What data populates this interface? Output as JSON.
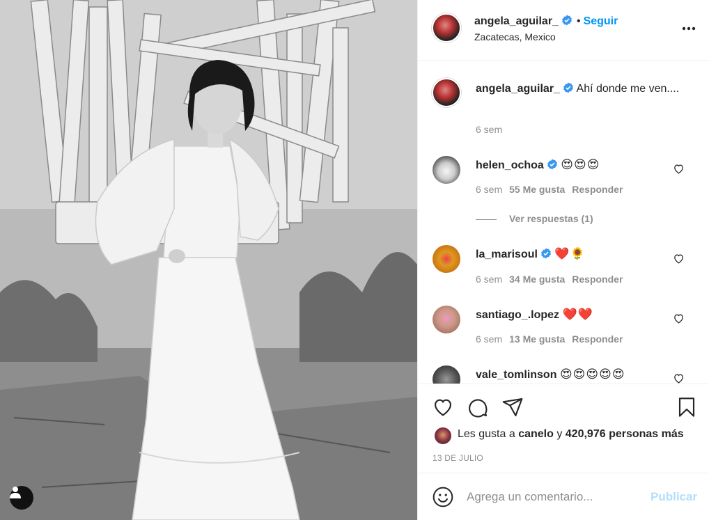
{
  "header": {
    "username": "angela_aguilar_",
    "separator": "•",
    "follow_label": "Seguir",
    "location": "Zacatecas, Mexico"
  },
  "caption": {
    "username": "angela_aguilar_",
    "text": "Ahí donde me ven....",
    "time": "6 sem"
  },
  "comments": [
    {
      "username": "helen_ochoa",
      "verified": true,
      "text": "😍😍😍",
      "time": "6 sem",
      "likes": "55 Me gusta",
      "reply": "Responder"
    },
    {
      "username": "la_marisoul",
      "verified": true,
      "text": "❤️🌻",
      "time": "6 sem",
      "likes": "34 Me gusta",
      "reply": "Responder"
    },
    {
      "username": "santiago_.lopez",
      "verified": false,
      "text": "❤️❤️",
      "time": "6 sem",
      "likes": "13 Me gusta",
      "reply": "Responder"
    },
    {
      "username": "vale_tomlinson",
      "verified": false,
      "text": "😍😍😍😍😍"
    }
  ],
  "view_replies": "Ver respuestas (1)",
  "likes": {
    "prefix": "Les gusta a",
    "user": "canelo",
    "connector": "y",
    "count": "420,976 personas más"
  },
  "date": "13 DE JULIO",
  "add_comment": {
    "placeholder": "Agrega un comentario...",
    "publish_label": "Publicar"
  },
  "colors": {
    "accent": "#0095f6",
    "verified": "#3897f0",
    "publish_disabled": "#b2dffc",
    "muted_text": "#8e8e8e"
  },
  "icons": {
    "more": "more-options-icon",
    "verified": "verified-badge-icon",
    "like": "heart-icon",
    "comment": "comment-bubble-icon",
    "share": "paper-plane-icon",
    "save": "bookmark-icon",
    "emoji": "smiley-icon",
    "tag": "user-tag-icon"
  }
}
